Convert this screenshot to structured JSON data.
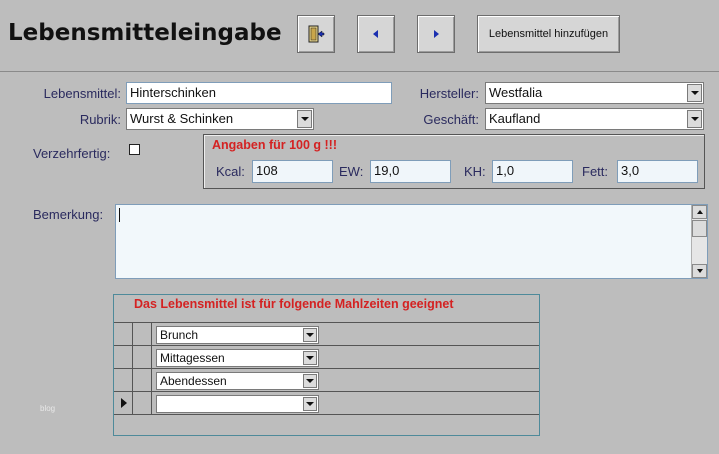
{
  "header": {
    "title": "Lebensmitteleingabe",
    "add_button_label": "Lebensmittel hinzufügen",
    "icons": [
      "exit-door-icon",
      "prev-record-icon",
      "next-record-icon"
    ]
  },
  "form": {
    "lebensmittel_label": "Lebensmittel:",
    "lebensmittel_value": "Hinterschinken",
    "rubrik_label": "Rubrik:",
    "rubrik_value": "Wurst & Schinken",
    "verzehrfertig_label": "Verzehrfertig:",
    "verzehrfertig_checked": false,
    "hersteller_label": "Hersteller:",
    "hersteller_value": "Westfalia",
    "geschaeft_label": "Geschäft:",
    "geschaeft_value": "Kaufland",
    "bemerkung_label": "Bemerkung:",
    "bemerkung_value": ""
  },
  "nutrition": {
    "title": "Angaben für 100 g !!!",
    "kcal_label": "Kcal:",
    "kcal_value": "108",
    "ew_label": "EW:",
    "ew_value": "19,0",
    "kh_label": "KH:",
    "kh_value": "1,0",
    "fett_label": "Fett:",
    "fett_value": "3,0"
  },
  "meals": {
    "title": "Das Lebensmittel ist für folgende Mahlzeiten geeignet",
    "rows": [
      "Brunch",
      "Mittagessen",
      "Abendessen",
      ""
    ]
  },
  "footer": {
    "watermark": "blog"
  },
  "colors": {
    "background": "#bdbdbd",
    "label": "#2a2a5e",
    "warning_red": "#d42222",
    "subform_border": "#4e8a9a"
  }
}
